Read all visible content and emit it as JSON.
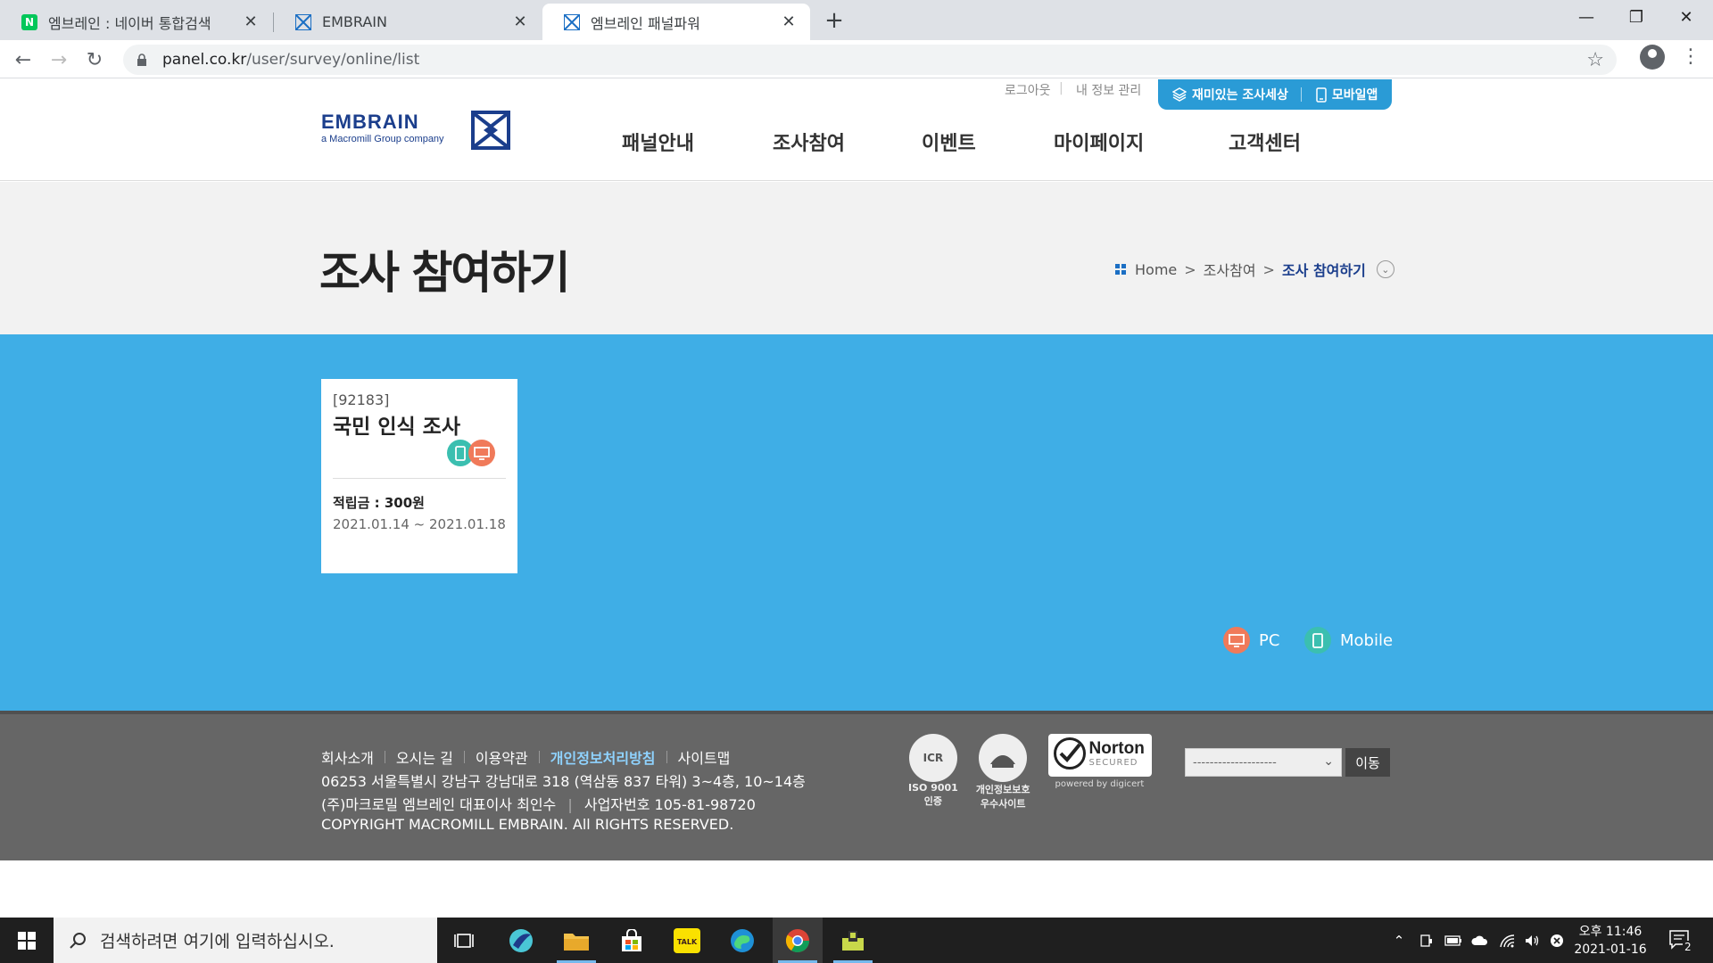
{
  "browser": {
    "tabs": [
      {
        "title": "엠브레인 : 네이버 통합검색",
        "favicon": "naver-icon",
        "active": false
      },
      {
        "title": "EMBRAIN",
        "favicon": "embrain-icon",
        "active": false
      },
      {
        "title": "엠브레인 패널파워",
        "favicon": "embrain-icon",
        "active": true
      }
    ],
    "url_host": "panel.co.kr",
    "url_path": "/user/survey/online/list"
  },
  "header": {
    "logo_word": "EMBRAIN",
    "logo_sub": "a Macromill Group company",
    "util_links": [
      "로그아웃",
      "내 정보 관리"
    ],
    "pill_items": [
      "재미있는 조사세상",
      "모바일앱"
    ],
    "gnb": [
      "패널안내",
      "조사참여",
      "이벤트",
      "마이페이지",
      "고객센터"
    ]
  },
  "titlebar": {
    "title": "조사 참여하기",
    "breadcrumb": [
      "Home",
      "조사참여",
      "조사 참여하기"
    ],
    "sep": ">"
  },
  "survey": {
    "code": "[92183]",
    "title": "국민 인식 조사",
    "reward_label": "적립금 : 300원",
    "period": "2021.01.14 ~ 2021.01.18"
  },
  "legend": {
    "pc": "PC",
    "mobile": "Mobile"
  },
  "footer": {
    "nav": [
      "회사소개",
      "오시는 길",
      "이용약관",
      "개인정보처리방침",
      "사이트맵"
    ],
    "address": "06253 서울특별시 강남구 강남대로 318 (역삼동 837 타워) 3~4층, 10~14층",
    "company_ceo": "(주)마크로밀 엠브레인 대표이사 최인수",
    "biz_no": "사업자번호 105-81-98720",
    "copyright": "COPYRIGHT MACROMILL EMBRAIN. All RIGHTS RESERVED.",
    "badges": [
      {
        "circle": "ICR",
        "label1": "ISO 9001",
        "label2": "인증"
      },
      {
        "circle": "",
        "label1": "개인정보보호",
        "label2": "우수사이트"
      }
    ],
    "norton": {
      "title": "Norton",
      "sub": "SECURED",
      "powered": "powered by digicert"
    },
    "select_value": "--------------------",
    "go_label": "이동"
  },
  "taskbar": {
    "search_placeholder": "검색하려면 여기에 입력하십시오.",
    "clock_time": "오후 11:46",
    "clock_date": "2021-01-16",
    "notif_count": "2"
  },
  "colors": {
    "brand_blue": "#1b3e8c",
    "survey_bg": "#3faee6",
    "pc": "#f07a5a",
    "mobile": "#3bbfb0"
  }
}
